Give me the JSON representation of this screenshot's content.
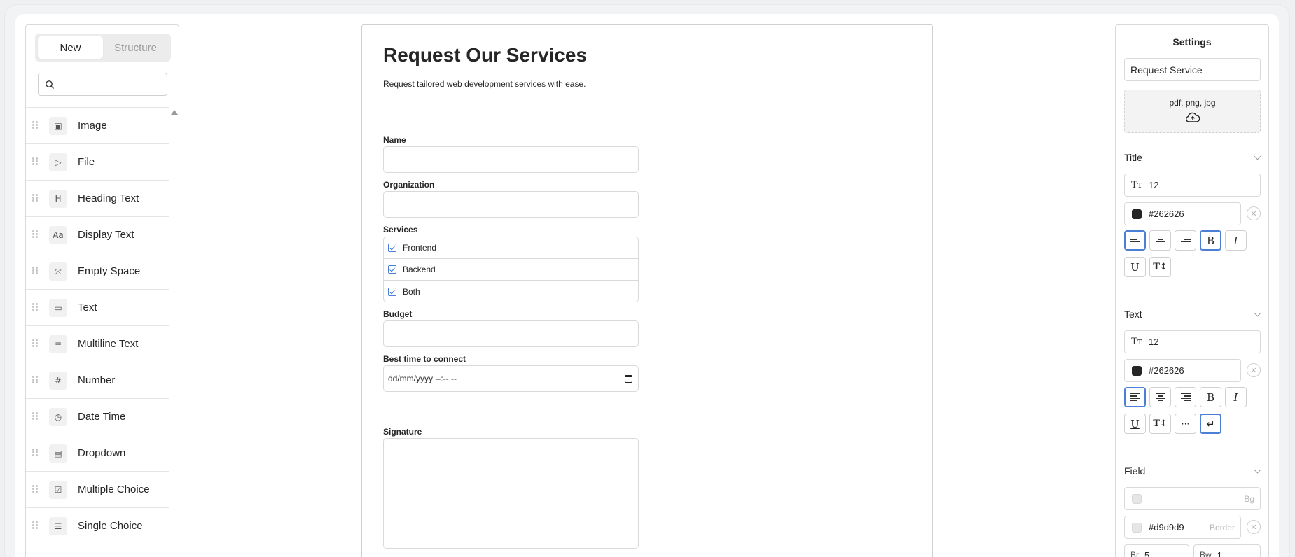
{
  "left_panel": {
    "tabs": {
      "new": "New",
      "structure": "Structure"
    },
    "search_placeholder": "",
    "items": [
      {
        "label": "Image",
        "icon": "image-icon",
        "glyph": "▣"
      },
      {
        "label": "File",
        "icon": "file-icon",
        "glyph": "▷"
      },
      {
        "label": "Heading Text",
        "icon": "heading-icon",
        "glyph": "H"
      },
      {
        "label": "Display Text",
        "icon": "display-text-icon",
        "glyph": "Aa"
      },
      {
        "label": "Empty Space",
        "icon": "empty-space-icon",
        "glyph": "⤧"
      },
      {
        "label": "Text",
        "icon": "text-field-icon",
        "glyph": "▭"
      },
      {
        "label": "Multiline Text",
        "icon": "multiline-text-icon",
        "glyph": "≡"
      },
      {
        "label": "Number",
        "icon": "number-icon",
        "glyph": "#"
      },
      {
        "label": "Date Time",
        "icon": "date-time-icon",
        "glyph": "◷"
      },
      {
        "label": "Dropdown",
        "icon": "dropdown-icon",
        "glyph": "▤"
      },
      {
        "label": "Multiple Choice",
        "icon": "multiple-choice-icon",
        "glyph": "☑"
      },
      {
        "label": "Single Choice",
        "icon": "single-choice-icon",
        "glyph": "☰"
      }
    ]
  },
  "form": {
    "title": "Request Our Services",
    "subtitle": "Request tailored web development services with ease.",
    "fields": {
      "name_label": "Name",
      "organization_label": "Organization",
      "services_label": "Services",
      "services_options": [
        "Frontend",
        "Backend",
        "Both"
      ],
      "budget_label": "Budget",
      "best_time_label": "Best time to connect",
      "best_time_placeholder": "dd/mm/yyyy --:-- --",
      "signature_label": "Signature"
    }
  },
  "settings": {
    "title": "Settings",
    "form_name": "Request Service",
    "upload_types": "pdf, png, jpg",
    "title_section": {
      "label": "Title",
      "size_glyph": "Tт",
      "font_size": "12",
      "color": "#262626"
    },
    "text_section": {
      "label": "Text",
      "size_glyph": "Tт",
      "font_size": "12",
      "color": "#262626"
    },
    "field_section": {
      "label": "Field",
      "bg_label": "Bg",
      "border_color": "#d9d9d9",
      "border_label": "Border",
      "br_label": "Br",
      "br_value": "5",
      "bw_label": "Bw",
      "bw_value": "1"
    },
    "format_glyphs": {
      "bold": "B",
      "italic": "I",
      "underline": "U",
      "line_height": "T↕",
      "ellipsis": "···",
      "wrap": "↵",
      "clear": "✕"
    }
  },
  "colors": {
    "accent": "#4a7fd4",
    "text": "#262626",
    "border": "#d9d9d9"
  }
}
